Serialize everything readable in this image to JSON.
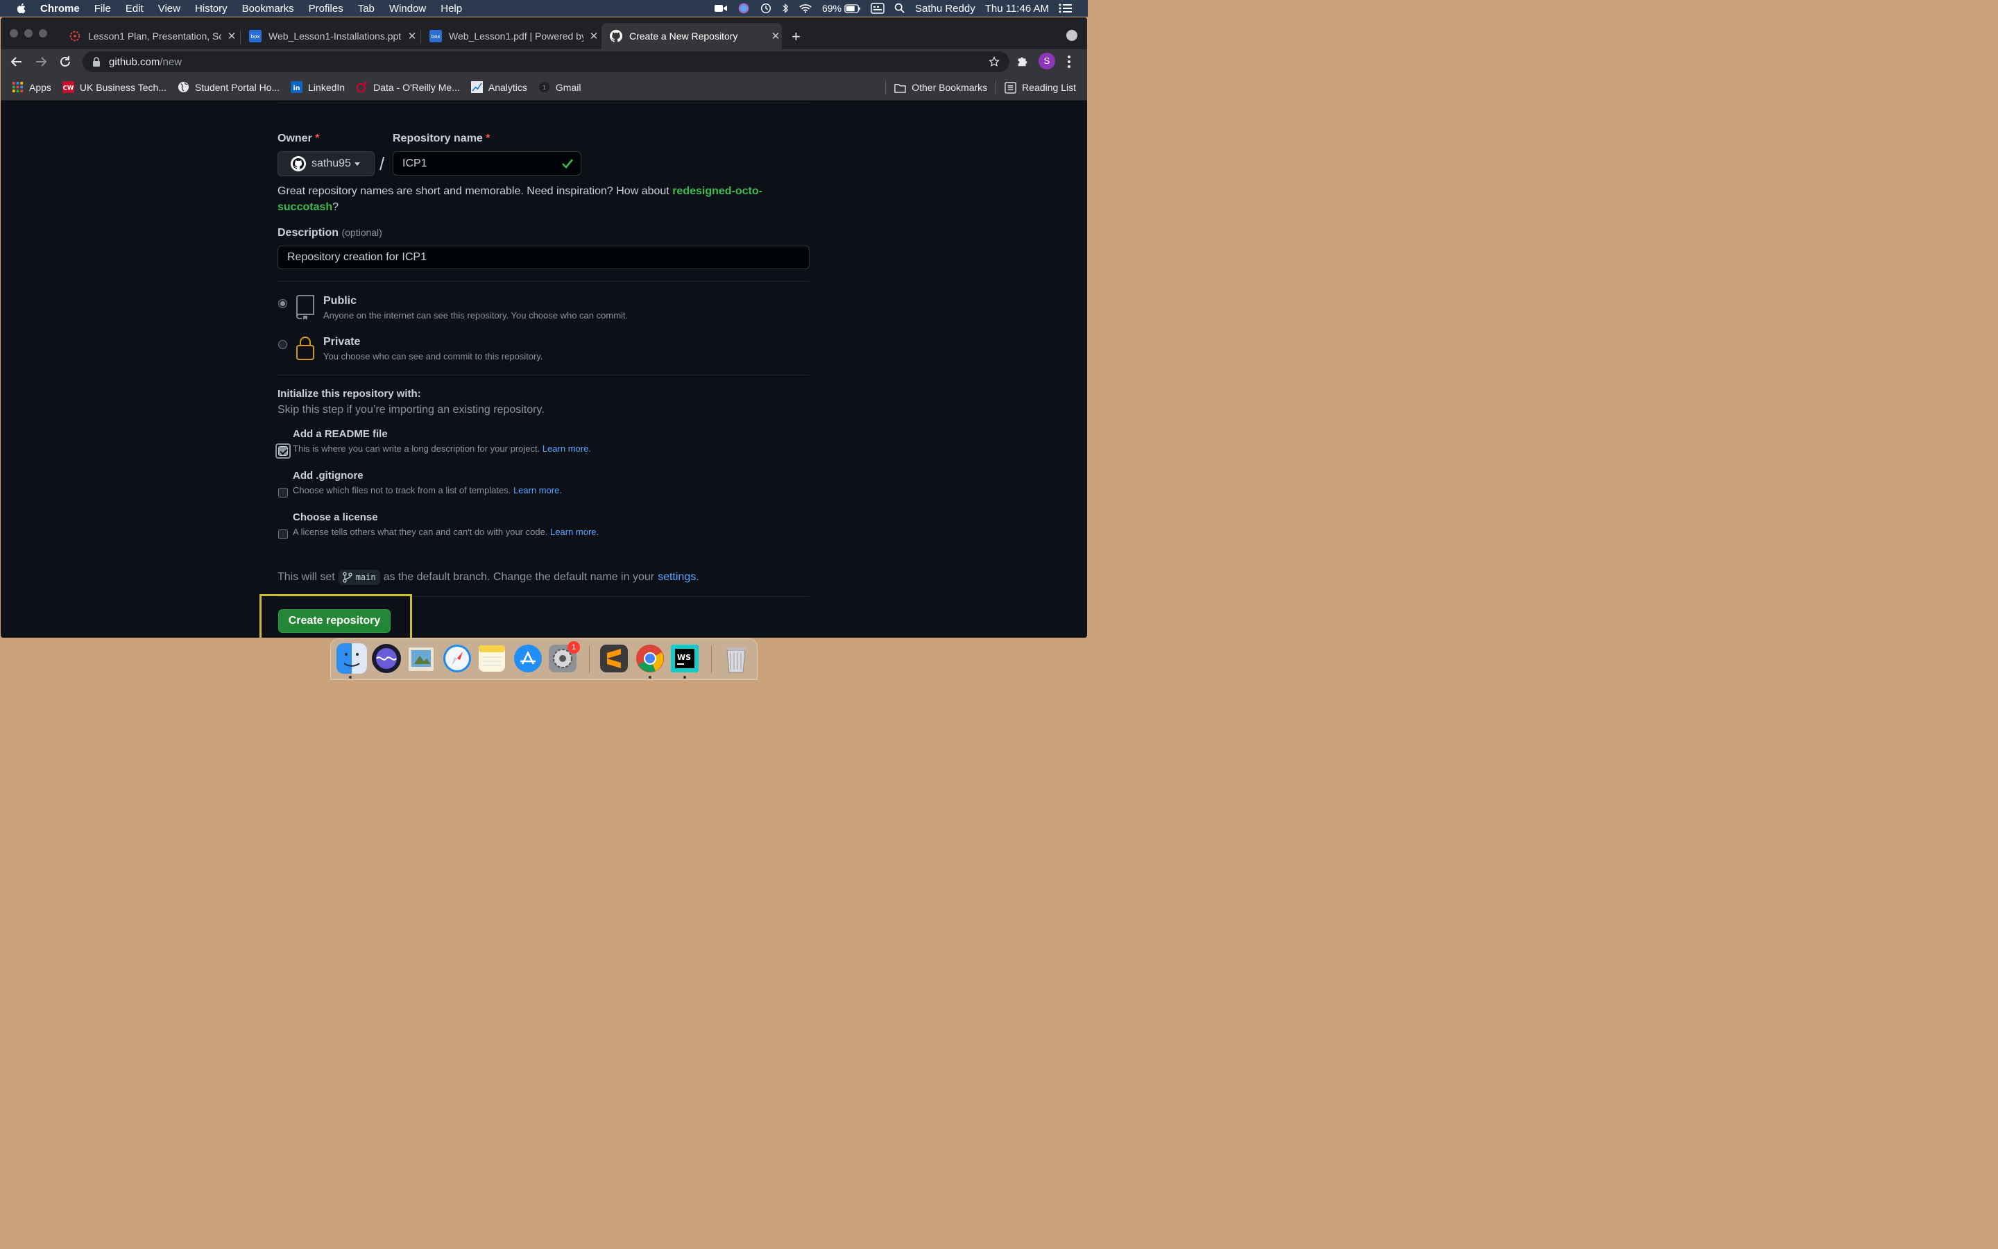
{
  "menubar": {
    "app": "Chrome",
    "items": [
      "File",
      "Edit",
      "View",
      "History",
      "Bookmarks",
      "Profiles",
      "Tab",
      "Window",
      "Help"
    ],
    "battery": "69%",
    "user": "Sathu Reddy",
    "clock": "Thu 11:46 AM"
  },
  "tabs": [
    {
      "title": "Lesson1 Plan, Presentation, So",
      "icon": "canvas-icon"
    },
    {
      "title": "Web_Lesson1-Installations.ppt",
      "icon": "box-icon"
    },
    {
      "title": "Web_Lesson1.pdf | Powered by",
      "icon": "box-icon"
    },
    {
      "title": "Create a New Repository",
      "icon": "github-icon",
      "active": true
    }
  ],
  "address": {
    "host": "github.com",
    "path": "/new"
  },
  "profile_initial": "S",
  "bookmarks": [
    "Apps",
    "UK Business Tech...",
    "Student Portal Ho...",
    "LinkedIn",
    "Data - O'Reilly Me...",
    "Analytics",
    "Gmail"
  ],
  "bookmarks_right": [
    "Other Bookmarks",
    "Reading List"
  ],
  "form": {
    "owner_label": "Owner",
    "required_mark": "*",
    "owner_value": "sathu95",
    "repo_label": "Repository name",
    "repo_value": "ICP1",
    "separator": "/",
    "hint_prefix": "Great repository names are short and memorable. Need inspiration? How about ",
    "hint_suggestion": "redesigned-octo-succotash",
    "hint_suffix": "?",
    "description_label": "Description",
    "description_optional": "(optional)",
    "description_value": "Repository creation for ICP1",
    "public": {
      "title": "Public",
      "desc": "Anyone on the internet can see this repository. You choose who can commit.",
      "selected": true
    },
    "private": {
      "title": "Private",
      "desc": "You choose who can see and commit to this repository.",
      "selected": false
    },
    "init_title": "Initialize this repository with:",
    "init_sub": "Skip this step if you’re importing an existing repository.",
    "readme": {
      "title": "Add a README file",
      "desc": "This is where you can write a long description for your project.",
      "link": "Learn more.",
      "checked": true
    },
    "gitignore": {
      "title": "Add .gitignore",
      "desc": "Choose which files not to track from a list of templates.",
      "link": "Learn more.",
      "checked": false
    },
    "license": {
      "title": "Choose a license",
      "desc": "A license tells others what they can and can't do with your code.",
      "link": "Learn more.",
      "checked": false
    },
    "branch_prefix": "This will set",
    "branch_name": "main",
    "branch_suffix": "as the default branch. Change the default name in your",
    "branch_link": "settings",
    "branch_end": ".",
    "submit_label": "Create repository"
  },
  "dock": {
    "apps": [
      "finder-icon",
      "siri-icon",
      "preview-icon",
      "safari-icon",
      "notes-icon",
      "app-store-icon",
      "system-preferences-icon",
      "sublime-text-icon",
      "chrome-icon",
      "webstorm-icon",
      "trash-icon"
    ],
    "system_preferences_badge": "1"
  },
  "colors": {
    "page_bg": "#0d1117",
    "accent_green": "#238636",
    "suggestion_green": "#3fb950",
    "link_blue": "#58a6ff",
    "highlight_box": "#c9c132"
  }
}
